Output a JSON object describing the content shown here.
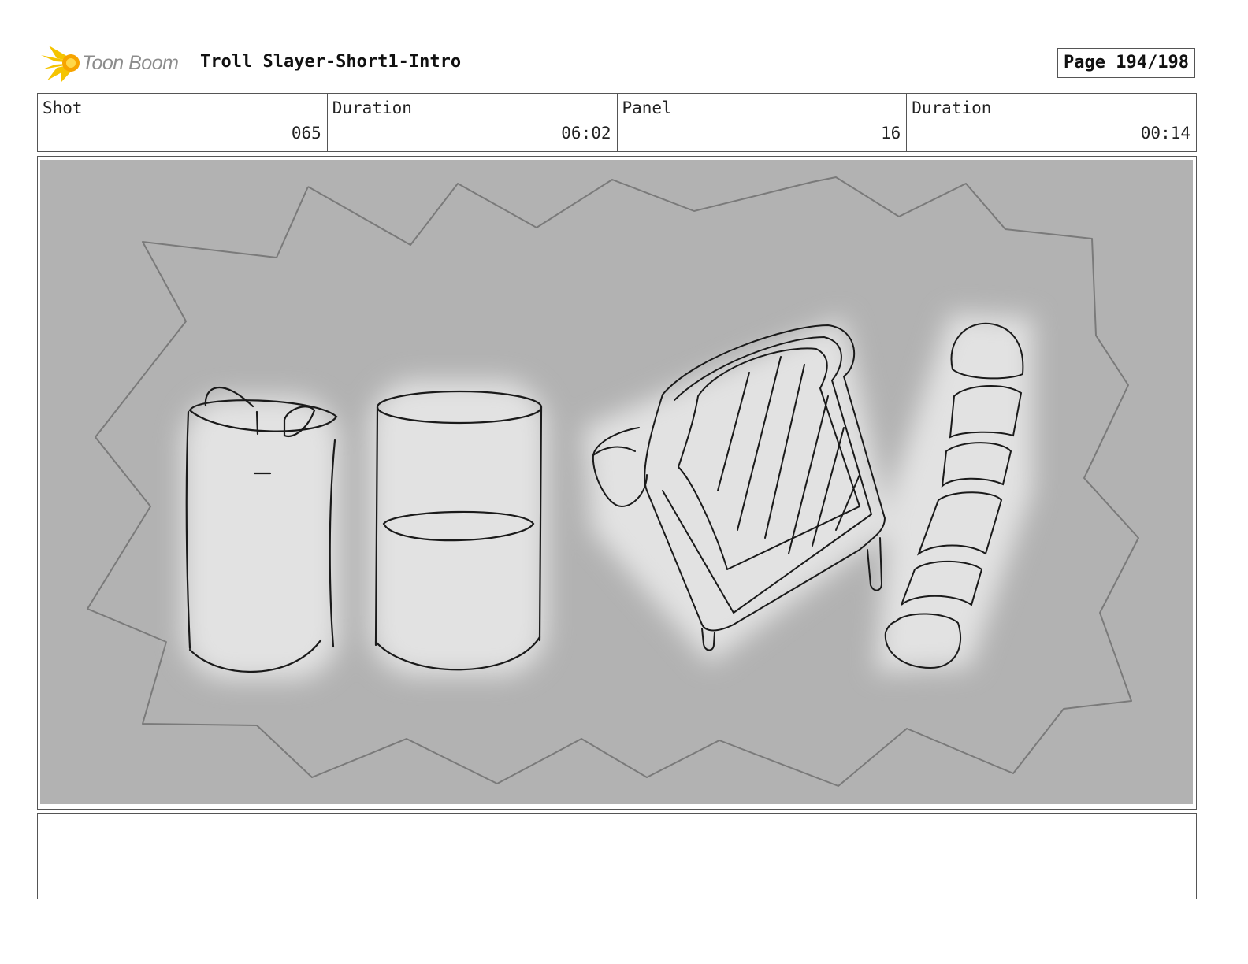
{
  "header": {
    "logo_text": "Toon Boom",
    "title": "Troll Slayer-Short1-Intro",
    "page": "Page 194/198"
  },
  "info": {
    "shot_label": "Shot",
    "shot_value": "065",
    "duration_label": "Duration",
    "duration_value": "06:02",
    "panel_label": "Panel",
    "panel_value": "16",
    "panel_duration_label": "Duration",
    "panel_duration_value": "00:14"
  },
  "colors": {
    "panel_background": "#b2b2b2",
    "logo_accent": "#f5c400",
    "sketch_line": "#1a1a1a"
  },
  "panel": {
    "depicts": [
      "soda-can",
      "glass-of-liquid",
      "sandwich",
      "hot-dog-slices",
      "burst-outline"
    ]
  },
  "notes": {
    "text": ""
  }
}
